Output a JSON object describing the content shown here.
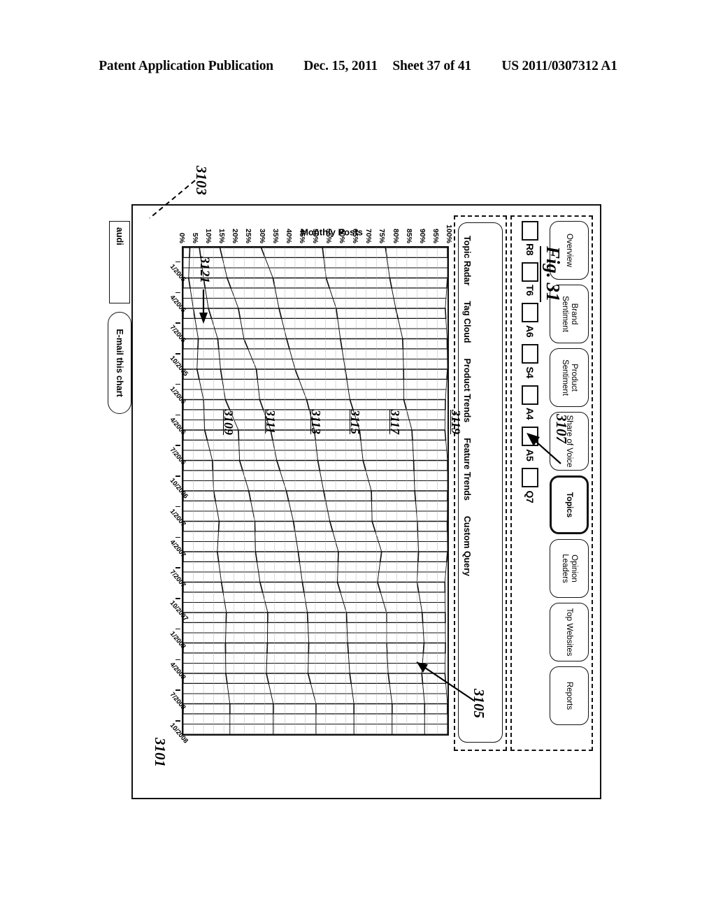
{
  "patent_header": {
    "publication": "Patent Application Publication",
    "date": "Dec. 15, 2011",
    "sheet": "Sheet 37 of 41",
    "number": "US 2011/0307312 A1"
  },
  "figure": {
    "caption": "Fig. 31",
    "reference_numerals": {
      "nav_region": "3103",
      "menu_region": "3101",
      "y_axis": "3105",
      "x_axis": "3107",
      "legend_q7": "3121",
      "band_1": "3109",
      "band_2": "3111",
      "band_3": "3113",
      "band_4": "3115",
      "band_5": "3117",
      "band_6": "3119"
    }
  },
  "app": {
    "tabs": [
      {
        "label": "Overview",
        "active": false
      },
      {
        "label": "Brand Sentiment",
        "active": false
      },
      {
        "label": "Product Sentiment",
        "active": false
      },
      {
        "label": "Share of Voice",
        "active": false
      },
      {
        "label": "Topics",
        "active": true
      },
      {
        "label": "Opinion Leaders",
        "active": false
      },
      {
        "label": "Top Websites",
        "active": false
      },
      {
        "label": "Reports",
        "active": false
      }
    ],
    "legend": [
      {
        "label": "R8",
        "checked": false
      },
      {
        "label": "T6",
        "checked": false
      },
      {
        "label": "A6",
        "checked": false
      },
      {
        "label": "S4",
        "checked": false
      },
      {
        "label": "A4",
        "checked": false
      },
      {
        "label": "A5",
        "checked": false
      },
      {
        "label": "Q7",
        "checked": false
      }
    ],
    "menu_items": [
      "Topic Radar",
      "Tag Cloud",
      "Product Trends",
      "Feature Trends",
      "Custom Query"
    ],
    "query_value": "audi",
    "email_button": "E-mail this chart"
  },
  "chart_data": {
    "type": "area",
    "title": "",
    "xlabel": "",
    "ylabel": "Monthly Posts",
    "ylim": [
      0,
      100
    ],
    "grid": false,
    "legend_position": "top",
    "stacked": true,
    "normalized_percent": true,
    "ytick_labels": [
      "100%",
      "95%",
      "90%",
      "85%",
      "80%",
      "75%",
      "70%",
      "65%",
      "60%",
      "55%",
      "50%",
      "45%",
      "40%",
      "35%",
      "30%",
      "25%",
      "20%",
      "15%",
      "10%",
      "5%",
      "0%"
    ],
    "x": [
      "1/2005",
      "4/2005",
      "7/2005",
      "10/2005",
      "1/2006",
      "4/2006",
      "7/2006",
      "10/2006",
      "1/2007",
      "4/2007",
      "7/2007",
      "10/2007",
      "1/2008",
      "4/2008",
      "7/2008",
      "10/2008"
    ],
    "series": [
      {
        "name": "R8",
        "values": [
          2,
          3,
          4,
          5,
          6,
          7,
          9,
          10,
          12,
          13,
          14,
          15,
          16,
          16,
          17,
          18
        ]
      },
      {
        "name": "T6",
        "values": [
          4,
          5,
          6,
          8,
          9,
          10,
          11,
          12,
          13,
          13,
          14,
          14,
          15,
          15,
          15,
          16
        ]
      },
      {
        "name": "A6",
        "values": [
          8,
          9,
          10,
          11,
          12,
          13,
          13,
          14,
          14,
          15,
          15,
          15,
          16,
          16,
          16,
          16
        ]
      },
      {
        "name": "S4",
        "values": [
          16,
          16,
          16,
          16,
          16,
          16,
          16,
          16,
          15,
          15,
          15,
          15,
          15,
          15,
          15,
          15
        ]
      },
      {
        "name": "A4",
        "values": [
          22,
          21,
          21,
          20,
          19,
          18,
          18,
          17,
          17,
          16,
          16,
          15,
          15,
          15,
          14,
          14
        ]
      },
      {
        "name": "A5",
        "values": [
          24,
          24,
          23,
          22,
          21,
          20,
          19,
          18,
          17,
          16,
          15,
          15,
          14,
          14,
          13,
          12
        ]
      },
      {
        "name": "Q7",
        "values": [
          24,
          22,
          20,
          18,
          17,
          16,
          14,
          13,
          12,
          12,
          11,
          11,
          9,
          9,
          10,
          9
        ]
      }
    ]
  }
}
